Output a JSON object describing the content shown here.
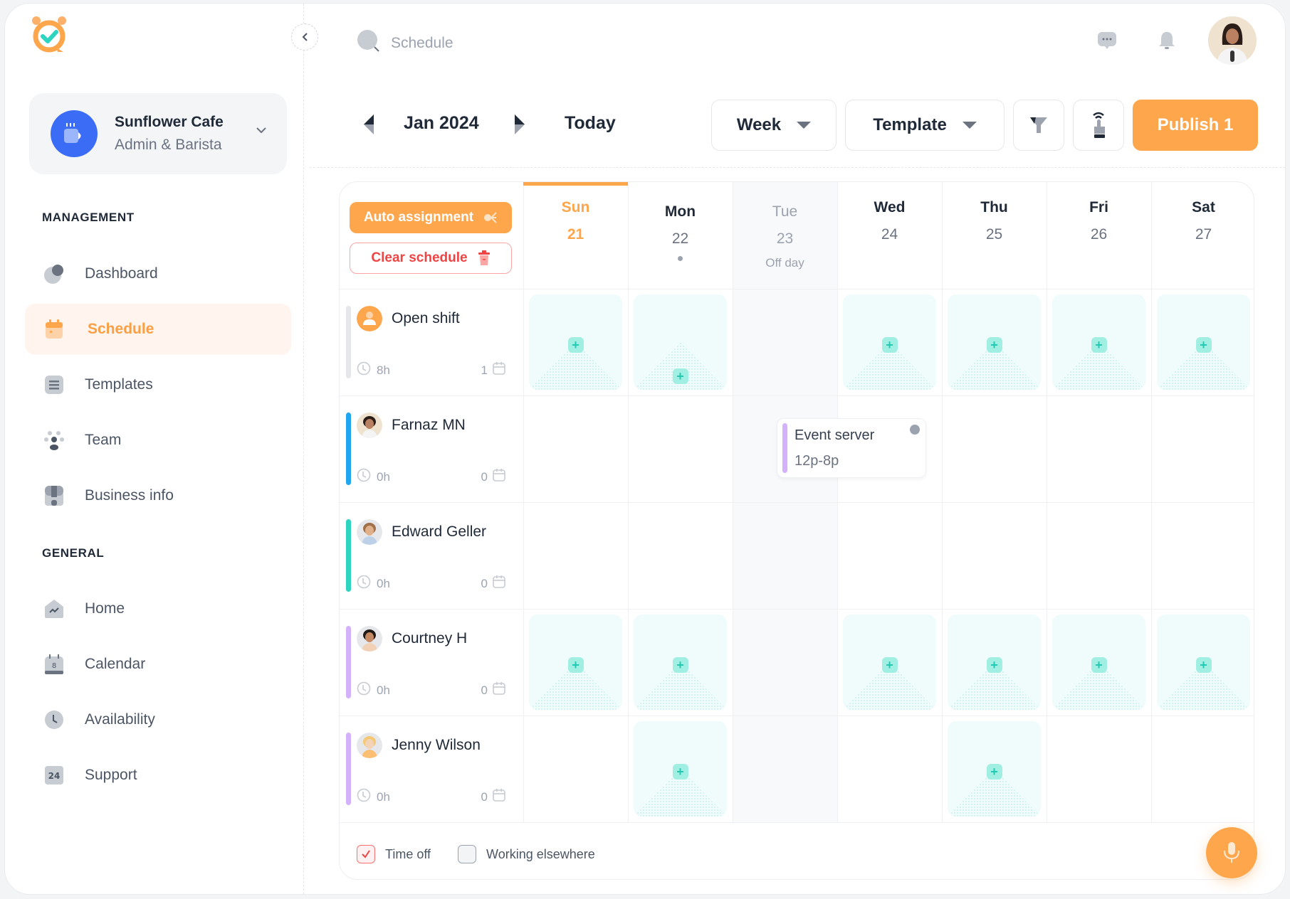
{
  "app": {
    "logo": "alarm-clock-check-logo",
    "org": {
      "name": "Sunflower Cafe",
      "role": "Admin & Barista"
    }
  },
  "sidebar": {
    "sections": [
      {
        "title": "MANAGEMENT",
        "items": [
          {
            "label": "Dashboard",
            "icon": "pie-chart-icon",
            "active": false
          },
          {
            "label": "Schedule",
            "icon": "calendar-icon",
            "active": true
          },
          {
            "label": "Templates",
            "icon": "list-icon",
            "active": false
          },
          {
            "label": "Team",
            "icon": "team-icon",
            "active": false
          },
          {
            "label": "Business info",
            "icon": "store-icon",
            "active": false
          }
        ]
      },
      {
        "title": "GENERAL",
        "items": [
          {
            "label": "Home",
            "icon": "home-icon",
            "active": false
          },
          {
            "label": "Calendar",
            "icon": "calendar-date-icon",
            "active": false
          },
          {
            "label": "Availability",
            "icon": "clock-icon",
            "active": false
          },
          {
            "label": "Support",
            "icon": "support-24-icon",
            "active": false
          }
        ]
      }
    ]
  },
  "topbar": {
    "search_placeholder": "Schedule"
  },
  "toolbar": {
    "period": "Jan 2024",
    "today": "Today",
    "view": "Week",
    "template": "Template",
    "publish": "Publish 1"
  },
  "schedule": {
    "auto_assignment": "Auto assignment",
    "clear_schedule": "Clear schedule",
    "days": [
      {
        "name": "Sun",
        "num": "21",
        "today": true
      },
      {
        "name": "Mon",
        "num": "22",
        "dot": true
      },
      {
        "name": "Tue",
        "num": "23",
        "sub": "Off day",
        "offday": true
      },
      {
        "name": "Wed",
        "num": "24"
      },
      {
        "name": "Thu",
        "num": "25"
      },
      {
        "name": "Fri",
        "num": "26"
      },
      {
        "name": "Sat",
        "num": "27"
      }
    ],
    "rows": [
      {
        "name": "Open shift",
        "hours": "8h",
        "count": "1",
        "bar_color": "#e5e7eb",
        "avatar": "open-shift",
        "slots": [
          0,
          1,
          3,
          4,
          5,
          6
        ]
      },
      {
        "name": "Farnaz MN",
        "hours": "0h",
        "count": "0",
        "bar_color": "#1fa6ee",
        "avatar": "photo",
        "slots": []
      },
      {
        "name": "Edward Geller",
        "hours": "0h",
        "count": "0",
        "bar_color": "#2dd4bf",
        "avatar": "photo",
        "slots": []
      },
      {
        "name": "Courtney H",
        "hours": "0h",
        "count": "0",
        "bar_color": "#d4b1fb",
        "avatar": "photo",
        "slots": [
          0,
          1,
          3,
          4,
          5,
          6
        ]
      },
      {
        "name": "Jenny Wilson",
        "hours": "0h",
        "count": "0",
        "bar_color": "#d4b1fb",
        "avatar": "photo",
        "slots": [
          1,
          4
        ]
      }
    ],
    "event": {
      "title": "Event server",
      "time": "12p-8p",
      "row": 1,
      "day": 2
    },
    "legend": [
      {
        "label": "Time off"
      },
      {
        "label": "Working elsewhere"
      }
    ]
  },
  "colors": {
    "accent": "#fea64c",
    "danger": "#ef4444",
    "teal": "#2dd4bf",
    "org_blue": "#3b6cf6"
  }
}
